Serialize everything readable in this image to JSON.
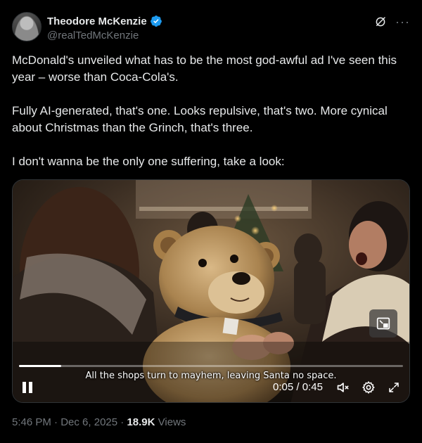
{
  "author": {
    "display_name": "Theodore McKenzie",
    "handle": "@realTedMcKenzie",
    "verified": true,
    "verified_color": "#1d9bf0"
  },
  "header_icons": [
    "grok-icon",
    "more-icon"
  ],
  "more_label": "···",
  "tweet": {
    "paragraphs": [
      "McDonald's unveiled what has to be the most god-awful ad I've seen this year – worse than Coca-Cola's.",
      "Fully AI-generated, that's one. Looks repulsive, that's two. More cynical about Christmas than the Grinch, that's three.",
      "I don't wanna be the only one suffering, take a look:"
    ]
  },
  "video": {
    "caption": "All the shops turn to mayhem, leaving Santa no space.",
    "current_time": "0:05",
    "separator": " / ",
    "duration": "0:45",
    "progress": 0.11,
    "playing": true,
    "muted": true
  },
  "meta": {
    "time": "5:46 PM",
    "date": "Dec 6, 2025",
    "views_count": "18.9K",
    "views_label": "Views",
    "dot": " · "
  },
  "colors": {
    "background": "#000000",
    "text": "#e7e9ea",
    "secondary": "#71767b"
  }
}
